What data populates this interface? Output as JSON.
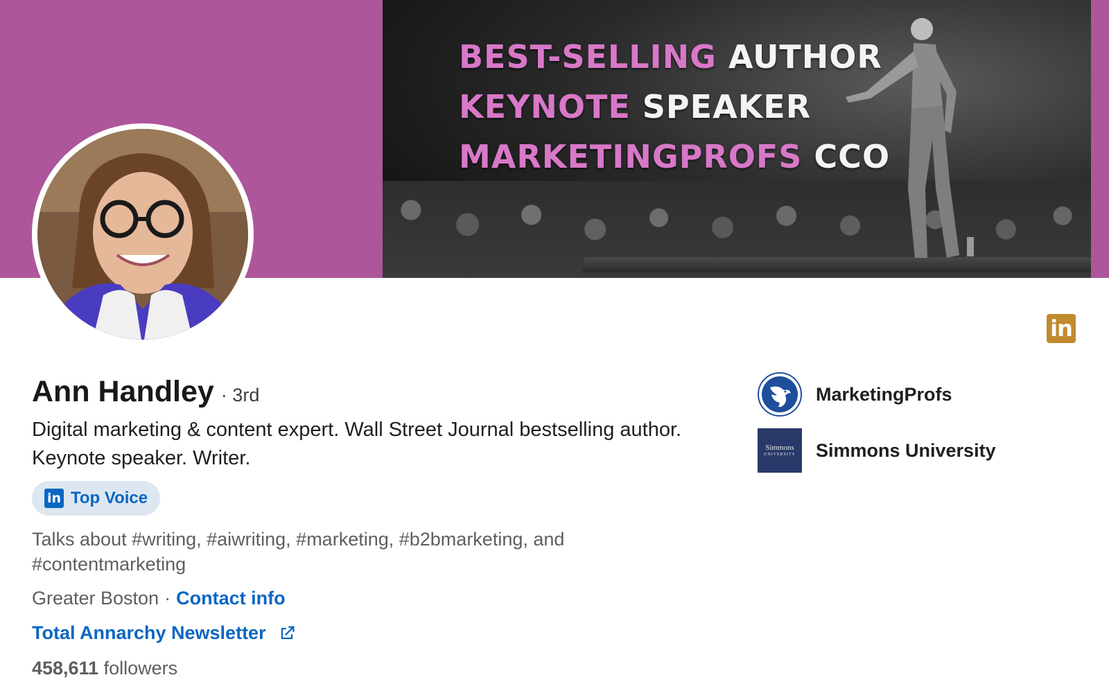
{
  "cover": {
    "banner_lines": [
      {
        "highlight": "BEST-SELLING",
        "rest": "AUTHOR"
      },
      {
        "highlight": "KEYNOTE",
        "rest": "SPEAKER"
      },
      {
        "highlight": "MARKETINGPROFS",
        "rest": "CCO"
      }
    ],
    "background_color": "#ad569b"
  },
  "profile": {
    "name": "Ann Handley",
    "degree": "· 3rd",
    "headline": "Digital marketing & content expert. Wall Street Journal bestselling author. Keynote speaker. Writer.",
    "top_voice_label": "Top Voice",
    "talks_about": "Talks about #writing, #aiwriting, #marketing, #b2bmarketing, and #contentmarketing",
    "location": "Greater Boston",
    "separator": "·",
    "contact_info_label": "Contact info",
    "newsletter_label": "Total Annarchy Newsletter",
    "followers_count": "458,611",
    "followers_label": "followers"
  },
  "organizations": [
    {
      "name": "MarketingProfs",
      "logo_icon": "bird-icon"
    },
    {
      "name": "Simmons University",
      "logo_text": "Simmons",
      "logo_subtext": "UNIVERSITY"
    }
  ],
  "linkedin_badge": {
    "text": "in",
    "color": "#c18a2e"
  },
  "colors": {
    "link": "#0a66c2",
    "top_voice_bg": "#dde7f1"
  }
}
